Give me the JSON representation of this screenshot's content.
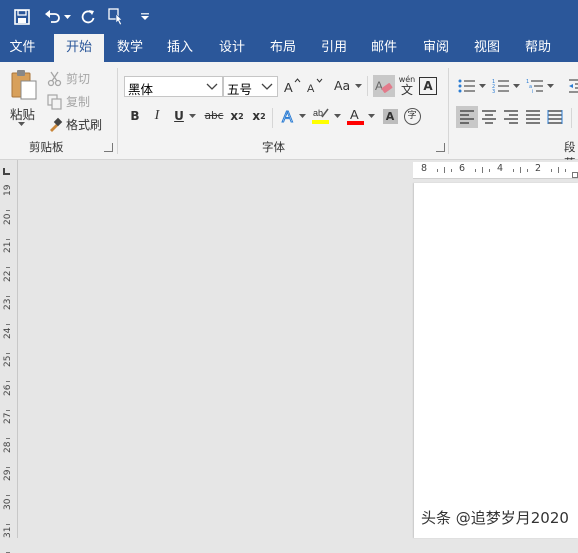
{
  "tabs": [
    {
      "label": "文件",
      "active": false
    },
    {
      "label": "开始",
      "active": true
    },
    {
      "label": "数学",
      "active": false
    },
    {
      "label": "插入",
      "active": false
    },
    {
      "label": "设计",
      "active": false
    },
    {
      "label": "布局",
      "active": false
    },
    {
      "label": "引用",
      "active": false
    },
    {
      "label": "邮件",
      "active": false
    },
    {
      "label": "审阅",
      "active": false
    },
    {
      "label": "视图",
      "active": false
    },
    {
      "label": "帮助",
      "active": false
    }
  ],
  "clipboard": {
    "paste_label": "粘贴",
    "cut_label": "剪切",
    "copy_label": "复制",
    "format_painter_label": "格式刷",
    "group_label": "剪贴板"
  },
  "font": {
    "font_name": "黑体",
    "font_size": "五号",
    "change_case_label": "Aa",
    "group_label": "字体",
    "phonetic_label": "wén",
    "phonetic_char": "文",
    "enclose_char": "字"
  },
  "paragraph": {
    "group_label": "段落"
  },
  "ruler": {
    "horizontal_numbers": [
      "8",
      "6",
      "4",
      "2"
    ],
    "vertical_numbers": [
      "19",
      "20",
      "21",
      "22",
      "23",
      "24",
      "25",
      "26",
      "27",
      "28",
      "29",
      "30",
      "31"
    ]
  },
  "watermark": "头条 @追梦岁月2020",
  "colors": {
    "titlebar": "#2b579a",
    "ribbon": "#f3f3f3",
    "highlight": "#ffff00",
    "font_color": "#ff0000"
  }
}
